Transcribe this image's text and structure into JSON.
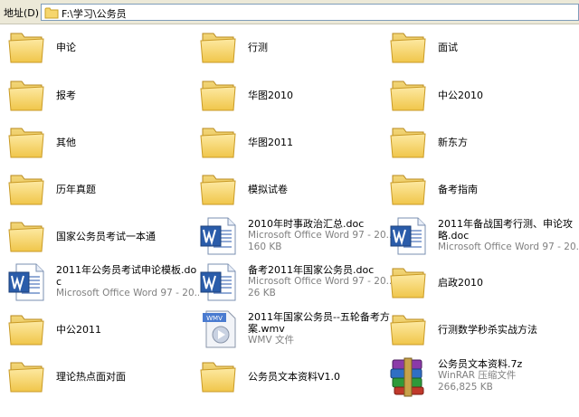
{
  "address_bar": {
    "label": "地址(D)",
    "path": "F:\\学习\\公务员"
  },
  "items": [
    {
      "name": "申论",
      "kind": "folder"
    },
    {
      "name": "行测",
      "kind": "folder"
    },
    {
      "name": "面试",
      "kind": "folder"
    },
    {
      "name": "报考",
      "kind": "folder"
    },
    {
      "name": "华图2010",
      "kind": "folder"
    },
    {
      "name": "中公2010",
      "kind": "folder"
    },
    {
      "name": "其他",
      "kind": "folder"
    },
    {
      "name": "华图2011",
      "kind": "folder"
    },
    {
      "name": "新东方",
      "kind": "folder"
    },
    {
      "name": "历年真题",
      "kind": "folder"
    },
    {
      "name": "模拟试卷",
      "kind": "folder"
    },
    {
      "name": "备考指南",
      "kind": "folder"
    },
    {
      "name": "国家公务员考试一本通",
      "kind": "folder"
    },
    {
      "name": "2010年时事政治汇总.doc",
      "kind": "word",
      "type": "Microsoft Office Word 97 - 20...",
      "size": "160 KB"
    },
    {
      "name": "2011年备战国考行测、申论攻略.doc",
      "kind": "word",
      "type": "Microsoft Office Word 97 - 20...",
      "size": ""
    },
    {
      "name": "2011年公务员考试申论模板.doc",
      "kind": "word",
      "type": "Microsoft Office Word 97 - 20...",
      "size": ""
    },
    {
      "name": "备考2011年国家公务员.doc",
      "kind": "word",
      "type": "Microsoft Office Word 97 - 20...",
      "size": "26 KB"
    },
    {
      "name": "启政2010",
      "kind": "folder"
    },
    {
      "name": "中公2011",
      "kind": "folder"
    },
    {
      "name": "2011年国家公务员--五轮备考方案.wmv",
      "kind": "wmv",
      "type": "WMV 文件",
      "size": ""
    },
    {
      "name": "行测数学秒杀实战方法",
      "kind": "folder"
    },
    {
      "name": "理论热点面对面",
      "kind": "folder"
    },
    {
      "name": "公务员文本资料V1.0",
      "kind": "folder"
    },
    {
      "name": "公务员文本资料.7z",
      "kind": "rar",
      "type": "WinRAR 压缩文件",
      "size": "266,825 KB"
    }
  ]
}
